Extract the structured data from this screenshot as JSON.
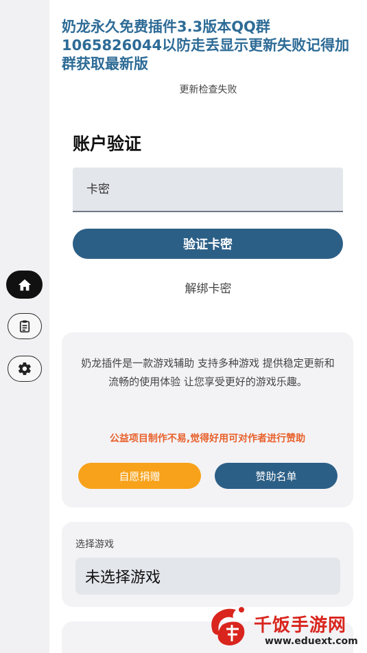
{
  "nav": {
    "items": [
      {
        "icon": "home-icon",
        "active": true
      },
      {
        "icon": "clipboard-icon",
        "active": false
      },
      {
        "icon": "gear-icon",
        "active": false
      }
    ]
  },
  "header": {
    "notice": "奶龙永久免费插件3.3版本QQ群1065826044以防走丢显示更新失败记得加群获取最新版",
    "update_status": "更新检查失败"
  },
  "account": {
    "title": "账户验证",
    "key_placeholder": "卡密",
    "verify_label": "验证卡密",
    "unbind_label": "解绑卡密"
  },
  "info_card": {
    "description": "奶龙插件是一款游戏辅助 支持多种游戏 提供稳定更新和流畅的使用体验 让您享受更好的游戏乐趣。",
    "charity_note": "公益项目制作不易,觉得好用可对作者进行赞助",
    "donate_label": "自愿捐赠",
    "sponsor_label": "赞助名单"
  },
  "game": {
    "label": "选择游戏",
    "selected": "未选择游戏"
  },
  "watermark": {
    "name": "千饭手游网",
    "url": "www.eduext.com"
  },
  "colors": {
    "primary": "#2c5f86",
    "accent_orange": "#f7a21a",
    "warning_text": "#e8602a",
    "notice_text": "#2d6b96"
  }
}
